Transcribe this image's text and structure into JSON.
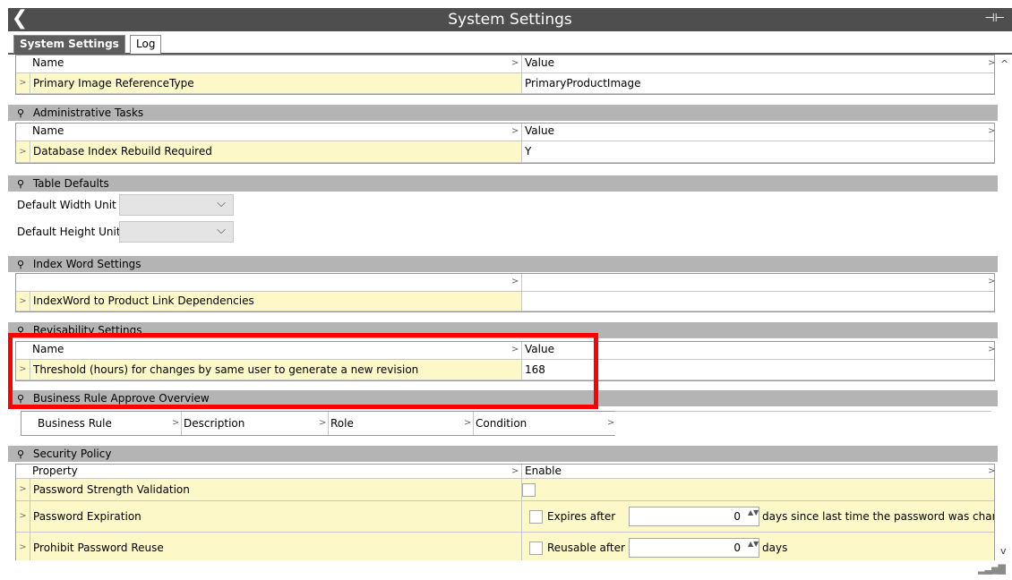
{
  "window": {
    "title": "System Settings",
    "back_glyph": "❮",
    "pin_glyph": "⊣⊢"
  },
  "tabs": [
    {
      "label": "System Settings",
      "active": true
    },
    {
      "label": "Log",
      "active": false
    }
  ],
  "top_grid": {
    "col_name": "Name",
    "col_value": "Value",
    "row_name": "Primary Image ReferenceType",
    "row_value": "PrimaryProductImage"
  },
  "admin_tasks": {
    "title": "Administrative Tasks",
    "col_name": "Name",
    "col_value": "Value",
    "row_name": "Database Index Rebuild Required",
    "row_value": "Y"
  },
  "table_defaults": {
    "title": "Table Defaults",
    "width_label": "Default Width Unit",
    "height_label": "Default Height Unit",
    "width_value": "",
    "height_value": ""
  },
  "index_word": {
    "title": "Index Word Settings",
    "row_name": "IndexWord to Product Link Dependencies",
    "row_value": ""
  },
  "revisability": {
    "title": "Revisability Settings",
    "col_name": "Name",
    "col_value": "Value",
    "row_name": "Threshold (hours) for changes by same user to generate a new revision",
    "row_value": "168"
  },
  "business_rule": {
    "title": "Business Rule Approve Overview",
    "columns": [
      "Business Rule",
      "Description",
      "Role",
      "Condition"
    ]
  },
  "security_policy": {
    "title": "Security Policy",
    "col_property": "Property",
    "col_enable": "Enable",
    "rows": [
      {
        "name": "Password Strength Validation"
      },
      {
        "name": "Password Expiration",
        "option_label": "Expires after",
        "value": "0",
        "suffix": "days since last time the password was changed"
      },
      {
        "name": "Prohibit Password Reuse",
        "option_label": "Reusable after",
        "value": "0",
        "suffix": "days"
      }
    ]
  },
  "glyphs": {
    "row_arrow": ">",
    "chevron": "⌵",
    "pin": "⚲",
    "scroll_up": "^",
    "scroll_down": "v",
    "spin": "▲▼",
    "signal": "▂▃▅▇"
  },
  "colors": {
    "titlebar": "#4e4e4e",
    "section_header": "#b4b4b4",
    "yellow_cell": "#fdf8c8",
    "highlight": "#ff0000"
  }
}
